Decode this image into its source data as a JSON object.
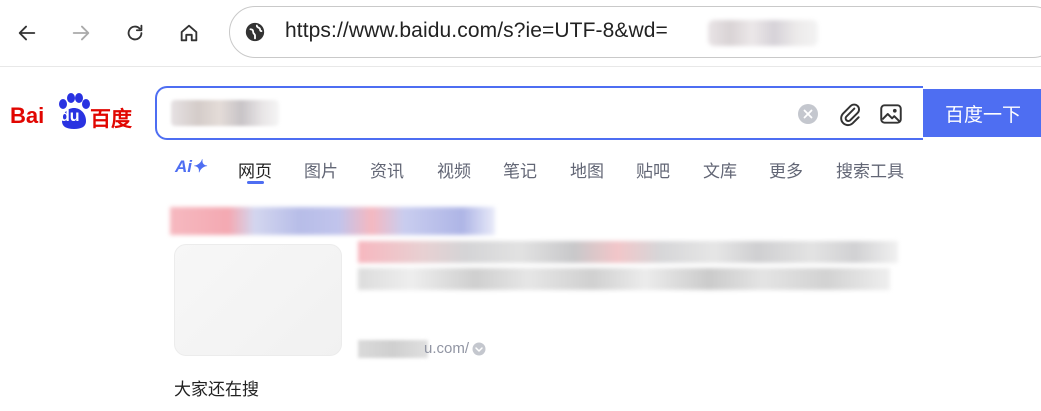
{
  "browser": {
    "url": "https://www.baidu.com/s?ie=UTF-8&wd=",
    "url_suffix": "."
  },
  "header": {
    "logo_text_left": "Bai",
    "logo_text_mid": "du",
    "logo_text_right": "百度",
    "search_button_label": "百度一下"
  },
  "tabs": {
    "ai_label": "Ai✦",
    "items": [
      {
        "label": "网页"
      },
      {
        "label": "图片"
      },
      {
        "label": "资讯"
      },
      {
        "label": "视频"
      },
      {
        "label": "笔记"
      },
      {
        "label": "地图"
      },
      {
        "label": "贴吧"
      },
      {
        "label": "文库"
      },
      {
        "label": "更多"
      },
      {
        "label": "搜索工具"
      }
    ]
  },
  "result": {
    "source_suffix": "u.com/"
  },
  "related": {
    "heading": "大家还在搜"
  },
  "colors": {
    "brand_blue": "#4e6ef2",
    "brand_red": "#e10601"
  }
}
